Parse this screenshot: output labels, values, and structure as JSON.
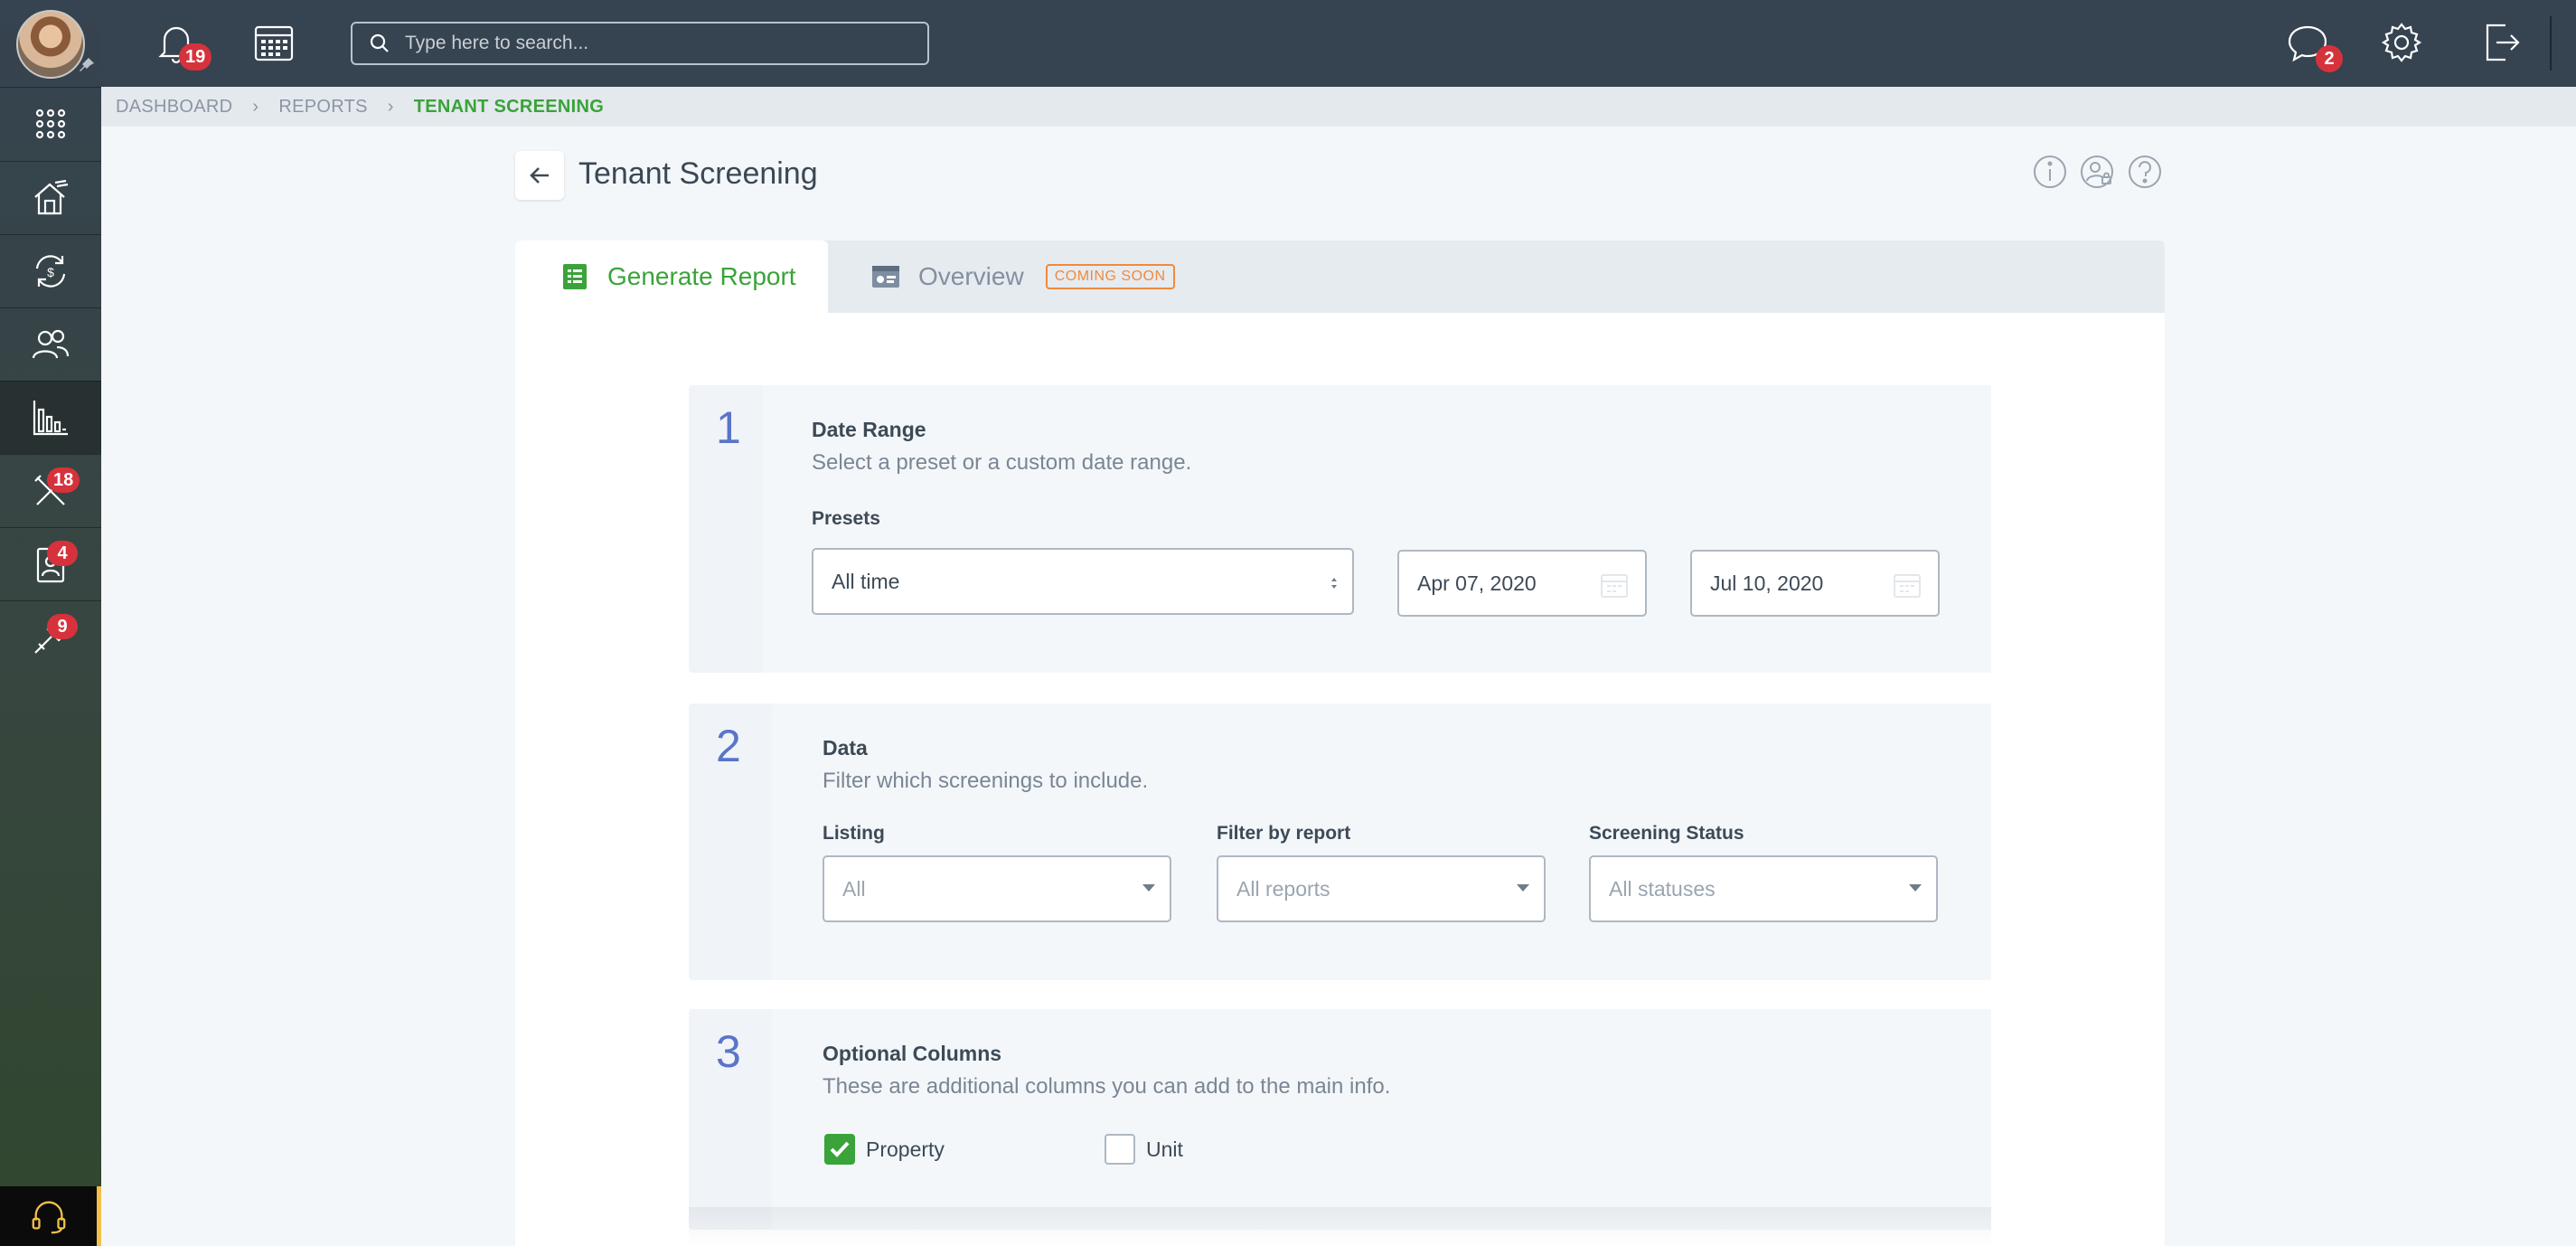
{
  "topbar": {
    "notifications_count": "19",
    "search_placeholder": "Type here to search...",
    "messages_count": "2"
  },
  "sidebar": {
    "items": [
      {
        "icon": "apps-grid-icon"
      },
      {
        "icon": "properties-icon"
      },
      {
        "icon": "accounting-icon"
      },
      {
        "icon": "people-icon"
      },
      {
        "icon": "reports-icon",
        "active": true
      },
      {
        "icon": "maintenance-icon",
        "badge": "18"
      },
      {
        "icon": "leasing-icon",
        "badge": "4"
      },
      {
        "icon": "tools-icon",
        "badge": "9"
      }
    ]
  },
  "breadcrumb": {
    "items": [
      "DASHBOARD",
      "REPORTS",
      "TENANT SCREENING"
    ],
    "separator": "›"
  },
  "page": {
    "title": "Tenant Screening"
  },
  "tabs": [
    {
      "label": "Generate Report",
      "active": true
    },
    {
      "label": "Overview",
      "badge": "COMING SOON"
    }
  ],
  "steps": {
    "date_range": {
      "number": "1",
      "title": "Date Range",
      "subtitle": "Select a preset or a custom date range.",
      "presets_label": "Presets",
      "preset_value": "All time",
      "start_date": "Apr 07, 2020",
      "end_date": "Jul 10, 2020"
    },
    "data": {
      "number": "2",
      "title": "Data",
      "subtitle": "Filter which screenings to include.",
      "listing_label": "Listing",
      "listing_value": "All",
      "filter_label": "Filter by report",
      "filter_value": "All reports",
      "status_label": "Screening Status",
      "status_value": "All statuses"
    },
    "columns": {
      "number": "3",
      "title": "Optional Columns",
      "subtitle": "These are additional columns you can add to the main info.",
      "options": [
        {
          "label": "Property",
          "checked": true
        },
        {
          "label": "Unit",
          "checked": false
        }
      ]
    }
  },
  "colors": {
    "accent_green": "#3aa339",
    "topbar": "#364350",
    "badge_red": "#d6323c",
    "step_blue": "#5a75c8",
    "coming_soon_orange": "#f08a3c"
  }
}
